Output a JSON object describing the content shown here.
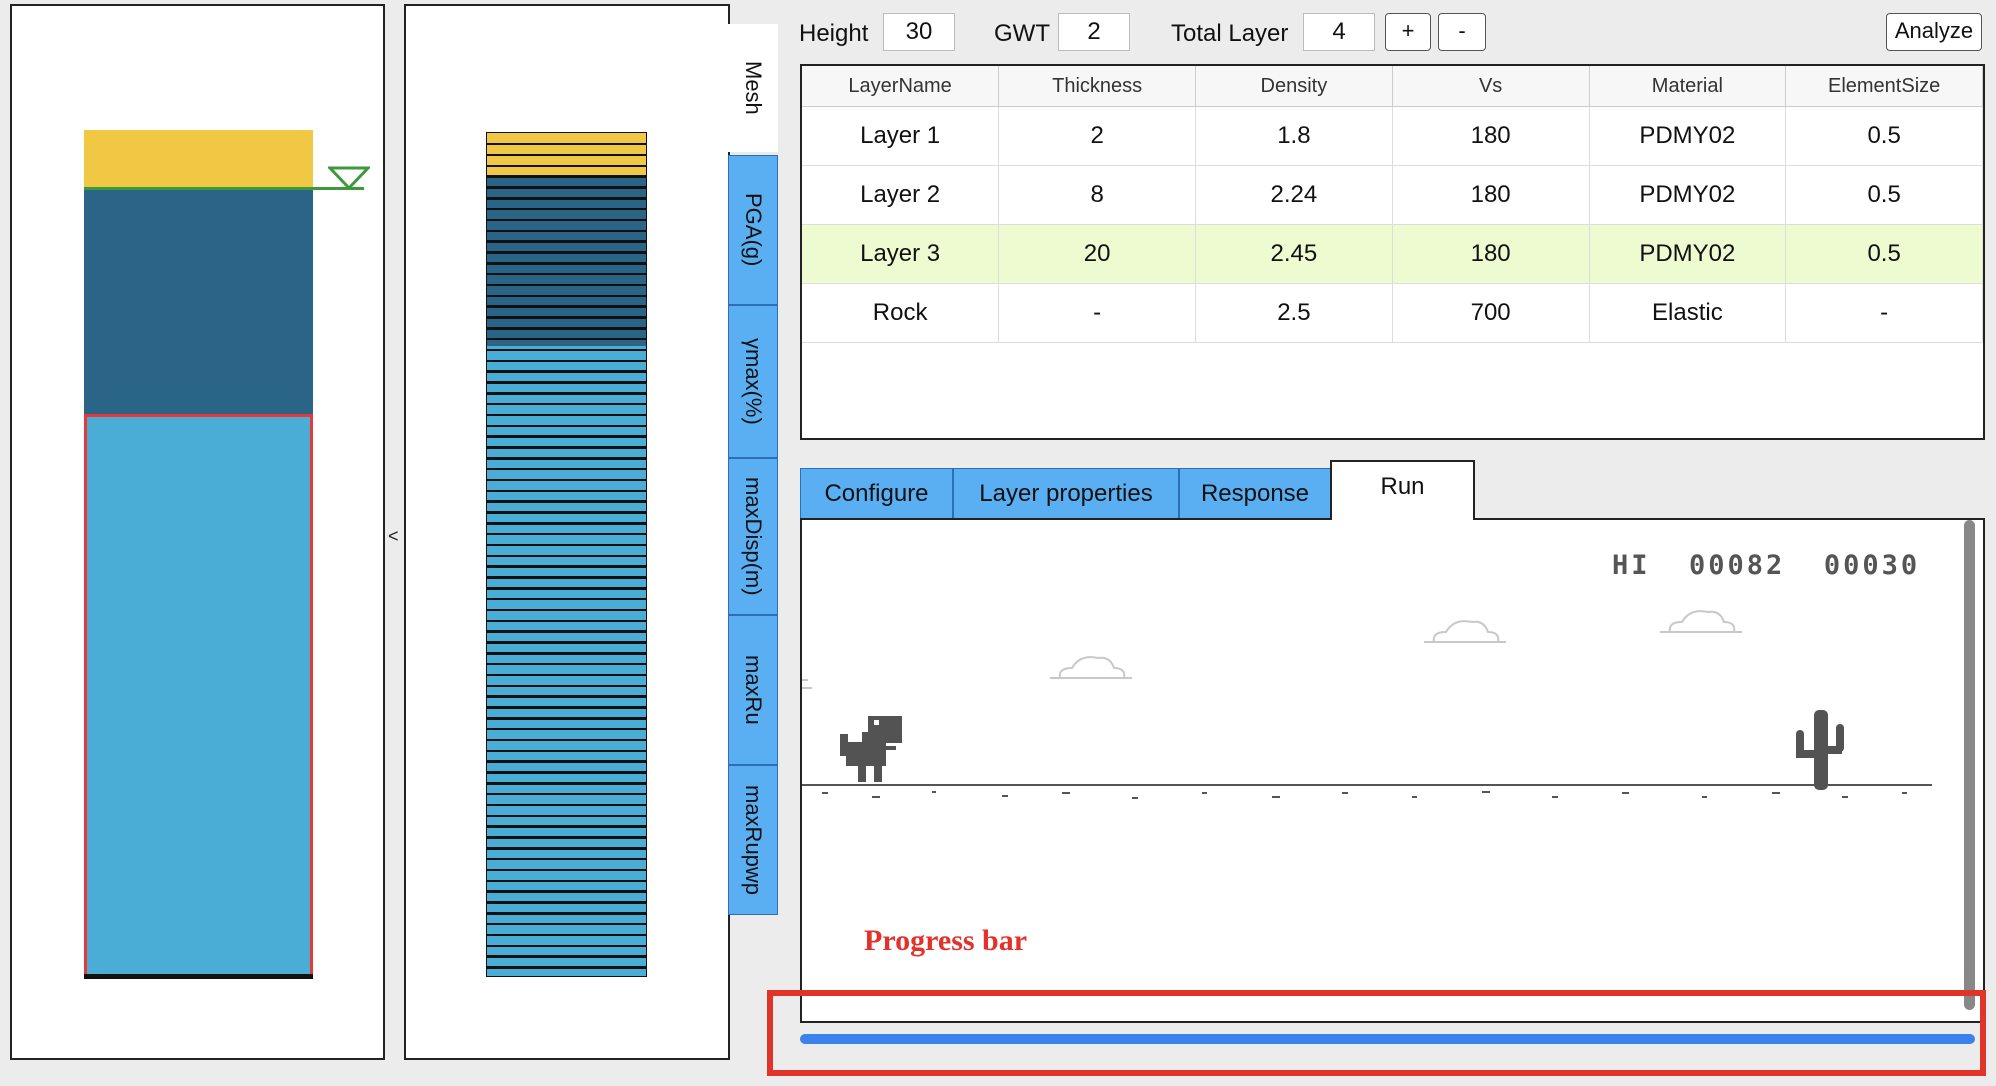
{
  "controls": {
    "height_label": "Height",
    "height_value": "30",
    "gwt_label": "GWT",
    "gwt_value": "2",
    "total_layer_label": "Total Layer",
    "total_layer_value": "4",
    "add_label": "+",
    "remove_label": "-",
    "analyze_label": "Analyze"
  },
  "left_collapse": "<",
  "side_tabs": {
    "mesh": "Mesh",
    "items": [
      "PGA(g)",
      "γmax(%)",
      "maxDisp(m)",
      "maxRu",
      "maxRupwp"
    ]
  },
  "table": {
    "headers": [
      "LayerName",
      "Thickness",
      "Density",
      "Vs",
      "Material",
      "ElementSize"
    ],
    "rows": [
      [
        "Layer 1",
        "2",
        "1.8",
        "180",
        "PDMY02",
        "0.5"
      ],
      [
        "Layer 2",
        "8",
        "2.24",
        "180",
        "PDMY02",
        "0.5"
      ],
      [
        "Layer 3",
        "20",
        "2.45",
        "180",
        "PDMY02",
        "0.5"
      ],
      [
        "Rock",
        "-",
        "2.5",
        "700",
        "Elastic",
        "-"
      ]
    ],
    "selected_row": 2
  },
  "tabs": [
    "Configure",
    "Layer properties",
    "Response",
    "Run"
  ],
  "active_tab": "Run",
  "game": {
    "hi_label": "HI",
    "hi_score": "00082",
    "score": "00030"
  },
  "progress_annotation": "Progress bar",
  "progress": 1.0,
  "colors": {
    "layer1": "#f0c844",
    "layer2": "#2a6486",
    "layer3": "#4aadd6",
    "tab": "#5aaef2",
    "progress": "#3b82ee",
    "highlight": "#e2332b"
  }
}
